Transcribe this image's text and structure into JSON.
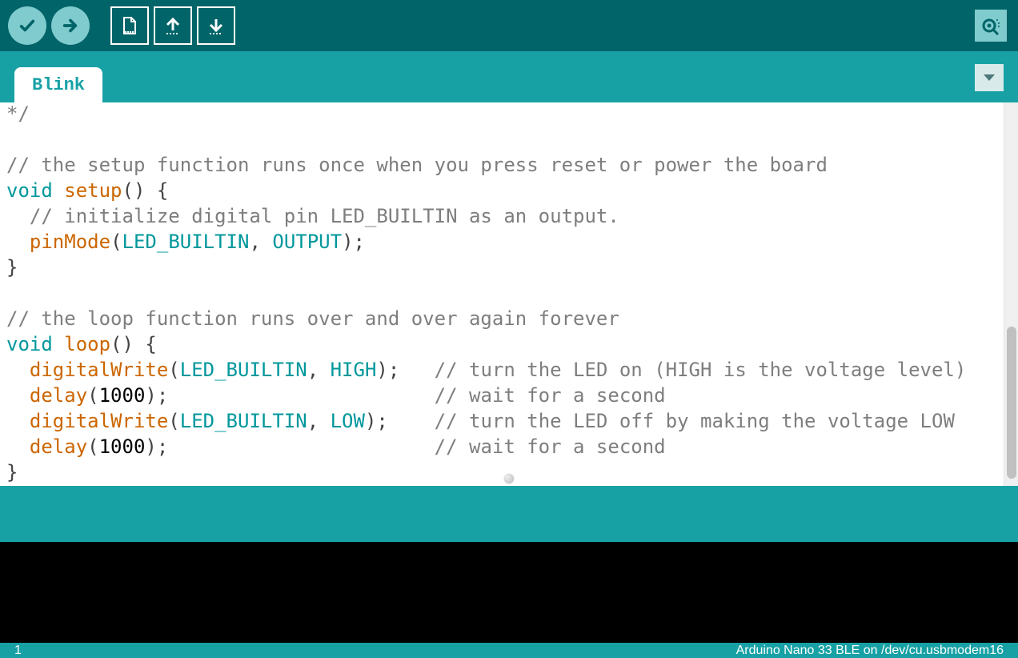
{
  "toolbar": {
    "verify": "Verify",
    "upload": "Upload",
    "new": "New",
    "open": "Open",
    "save": "Save",
    "serial": "Serial Monitor"
  },
  "tabs": {
    "active": "Blink",
    "menu": "Tab Menu"
  },
  "code": {
    "l0": "*/",
    "l1": "",
    "l2": "// the setup function runs once when you press reset or power the board",
    "l3_kw": "void",
    "l3_fn": "setup",
    "l3_rest": "() {",
    "l4": "  // initialize digital pin LED_BUILTIN as an output.",
    "l5_ind": "  ",
    "l5_fn": "pinMode",
    "l5_p1": "(",
    "l5_c1": "LED_BUILTIN",
    "l5_s1": ", ",
    "l5_c2": "OUTPUT",
    "l5_p2": ");",
    "l6": "}",
    "l7": "",
    "l8": "// the loop function runs over and over again forever",
    "l9_kw": "void",
    "l9_fn": "loop",
    "l9_rest": "() {",
    "l10_ind": "  ",
    "l10_fn": "digitalWrite",
    "l10_p1": "(",
    "l10_c1": "LED_BUILTIN",
    "l10_s1": ", ",
    "l10_c2": "HIGH",
    "l10_p2": ");   ",
    "l10_com": "// turn the LED on (HIGH is the voltage level)",
    "l11_ind": "  ",
    "l11_fn": "delay",
    "l11_p1": "(",
    "l11_n": "1000",
    "l11_p2": ");                       ",
    "l11_com": "// wait for a second",
    "l12_ind": "  ",
    "l12_fn": "digitalWrite",
    "l12_p1": "(",
    "l12_c1": "LED_BUILTIN",
    "l12_s1": ", ",
    "l12_c2": "LOW",
    "l12_p2": ");    ",
    "l12_com": "// turn the LED off by making the voltage LOW",
    "l13_ind": "  ",
    "l13_fn": "delay",
    "l13_p1": "(",
    "l13_n": "1000",
    "l13_p2": ");                       ",
    "l13_com": "// wait for a second",
    "l14": "}"
  },
  "status": {
    "line": "1",
    "board": "Arduino Nano 33 BLE on /dev/cu.usbmodem16"
  }
}
